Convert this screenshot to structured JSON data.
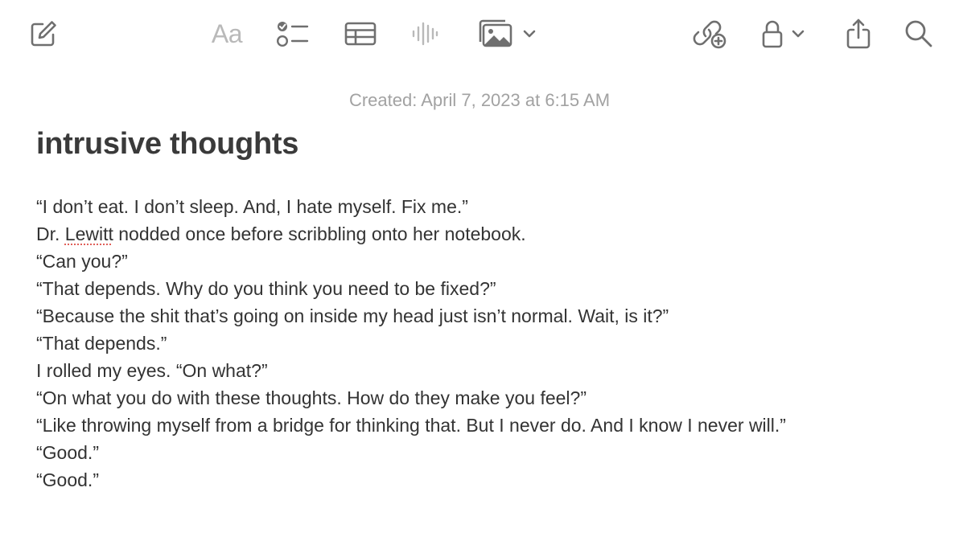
{
  "toolbar": {
    "compose_icon": "compose-icon",
    "format_label": "Aa",
    "checklist_icon": "checklist-icon",
    "table_icon": "table-icon",
    "audio_icon": "audio-waveform-icon",
    "media_icon": "photo-gallery-icon",
    "collaborate_icon": "link-plus-icon",
    "lock_icon": "lock-icon",
    "share_icon": "share-icon",
    "search_icon": "search-icon"
  },
  "note": {
    "created": "Created: April 7, 2023 at 6:15 AM",
    "title": "intrusive thoughts",
    "lines": [
      "“I don’t eat. I don’t sleep. And, I hate myself. Fix me.”",
      {
        "before": "Dr. ",
        "flagged": "Lewitt",
        "after": " nodded once before scribbling onto her notebook."
      },
      "“Can you?”",
      "“That depends. Why do you think you need to be fixed?”",
      "“Because the shit that’s going on inside my head just isn’t normal. Wait, is it?”",
      "“That depends.”",
      "I rolled my eyes. “On what?”",
      "“On what you do with these thoughts. How do they make you feel?”",
      "“Like throwing myself from a bridge for thinking that. But I never do. And I know I never will.”",
      "“Good.”",
      "“Good.”"
    ]
  },
  "colors": {
    "icon": "#6f6f6f",
    "icon_disabled": "#b9b9b9",
    "meta_text": "#a2a2a2",
    "title_text": "#3a3a3a",
    "body_text": "#333333",
    "spellcheck": "#e0605a"
  }
}
